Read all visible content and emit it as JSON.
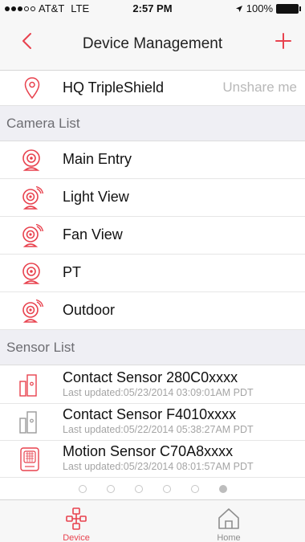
{
  "status_bar": {
    "carrier": "AT&T",
    "network": "LTE",
    "time": "2:57 PM",
    "battery": "100%"
  },
  "nav": {
    "title": "Device Management",
    "back_icon": "chevron-left-icon",
    "add_icon": "plus-icon"
  },
  "hub": {
    "name": "HQ TripleShield",
    "action": "Unshare me",
    "icon": "location-pin-icon"
  },
  "camera_list": {
    "header": "Camera List",
    "items": [
      {
        "label": "Main Entry",
        "icon": "camera-icon"
      },
      {
        "label": "Light View",
        "icon": "wireless-camera-icon"
      },
      {
        "label": "Fan View",
        "icon": "wireless-camera-icon"
      },
      {
        "label": "PT",
        "icon": "camera-icon"
      },
      {
        "label": "Outdoor",
        "icon": "wireless-camera-icon"
      }
    ]
  },
  "sensor_list": {
    "header": "Sensor List",
    "items": [
      {
        "name": "Contact Sensor 280C0xxxx",
        "updated": "Last updated:05/23/2014 03:09:01AM PDT",
        "icon": "contact-sensor-icon",
        "active": true
      },
      {
        "name": "Contact Sensor F4010xxxx",
        "updated": "Last updated:05/22/2014 05:38:27AM PDT",
        "icon": "contact-sensor-icon",
        "active": false
      },
      {
        "name": "Motion Sensor C70A8xxxx",
        "updated": "Last updated:05/23/2014 08:01:57AM PDT",
        "icon": "motion-sensor-icon",
        "active": true
      }
    ]
  },
  "page_indicator": {
    "count": 6,
    "active_index": 5
  },
  "tabs": [
    {
      "label": "Device",
      "icon": "device-network-icon",
      "selected": true
    },
    {
      "label": "Home",
      "icon": "home-icon",
      "selected": false
    }
  ],
  "colors": {
    "accent": "#e8424e",
    "muted": "#a5a5a5",
    "section_bg": "#efeff4"
  }
}
